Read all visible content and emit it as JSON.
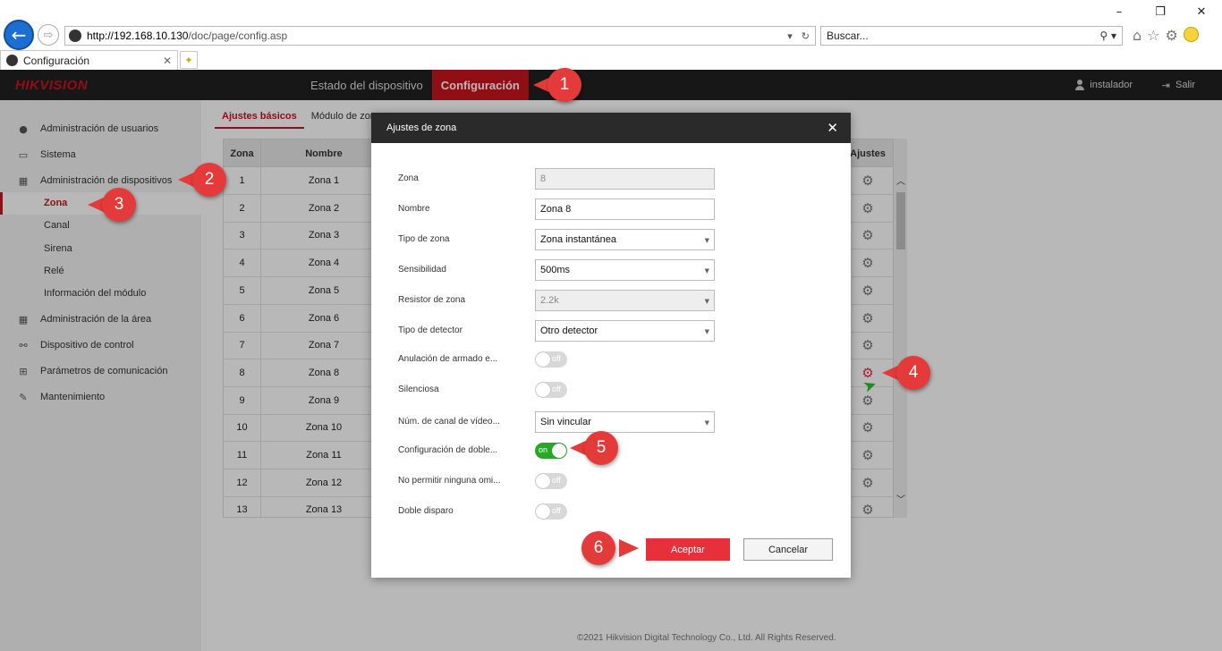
{
  "browser": {
    "url_host": "http://192.168.10.130",
    "url_path": "/doc/page/config.asp",
    "search_placeholder": "Buscar...",
    "tab_title": "Configuración"
  },
  "header": {
    "logo": "HIKVISION",
    "nav": [
      "Estado del dispositivo",
      "Configuración"
    ],
    "user": "instalador",
    "logout": "Salir"
  },
  "sidebar": {
    "items": [
      {
        "label": "Administración de usuarios",
        "icon": "user-icon"
      },
      {
        "label": "Sistema",
        "icon": "monitor-icon"
      },
      {
        "label": "Administración de dispositivos",
        "icon": "grid-icon"
      }
    ],
    "subitems": [
      "Zona",
      "Canal",
      "Sirena",
      "Relé",
      "Información del módulo"
    ],
    "items2": [
      {
        "label": "Administración de la área",
        "icon": "grid-icon"
      },
      {
        "label": "Dispositivo de control",
        "icon": "control-icon"
      },
      {
        "label": "Parámetros de comunicación",
        "icon": "network-icon"
      },
      {
        "label": "Mantenimiento",
        "icon": "wrench-icon"
      }
    ]
  },
  "content": {
    "subtabs": [
      "Ajustes básicos",
      "Módulo de zona"
    ],
    "table": {
      "headers": [
        "Zona",
        "Nombre",
        "Ajustes"
      ],
      "rows": [
        [
          "1",
          "Zona 1"
        ],
        [
          "2",
          "Zona 2"
        ],
        [
          "3",
          "Zona 3"
        ],
        [
          "4",
          "Zona 4"
        ],
        [
          "5",
          "Zona 5"
        ],
        [
          "6",
          "Zona 6"
        ],
        [
          "7",
          "Zona 7"
        ],
        [
          "8",
          "Zona 8"
        ],
        [
          "9",
          "Zona 9"
        ],
        [
          "10",
          "Zona 10"
        ],
        [
          "11",
          "Zona 11"
        ],
        [
          "12",
          "Zona 12"
        ],
        [
          "13",
          "Zona 13"
        ]
      ]
    },
    "footer": "©2021 Hikvision Digital Technology Co., Ltd. All Rights Reserved."
  },
  "dialog": {
    "title": "Ajustes de zona",
    "fields": {
      "zona": {
        "label": "Zona",
        "value": "8"
      },
      "nombre": {
        "label": "Nombre",
        "value": "Zona 8"
      },
      "tipo_zona": {
        "label": "Tipo de zona",
        "value": "Zona instantánea"
      },
      "sensibilidad": {
        "label": "Sensibilidad",
        "value": "500ms"
      },
      "resistor": {
        "label": "Resistor de zona",
        "value": "2.2k"
      },
      "tipo_detector": {
        "label": "Tipo de detector",
        "value": "Otro detector"
      },
      "anulacion": {
        "label": "Anulación de armado e...",
        "value": "off"
      },
      "silenciosa": {
        "label": "Silenciosa",
        "value": "off"
      },
      "canal_video": {
        "label": "Núm. de canal de vídeo...",
        "value": "Sin vincular"
      },
      "config_doble": {
        "label": "Configuración de doble...",
        "value": "on"
      },
      "no_permitir": {
        "label": "No permitir ninguna omi...",
        "value": "off"
      },
      "doble_disparo": {
        "label": "Doble disparo",
        "value": "off"
      }
    },
    "ok_label": "Aceptar",
    "cancel_label": "Cancelar"
  },
  "callouts": [
    "1",
    "2",
    "3",
    "4",
    "5",
    "6"
  ],
  "colors": {
    "accent": "#c7161d",
    "callout": "#e53a3a",
    "toggle_on": "#27a925"
  }
}
